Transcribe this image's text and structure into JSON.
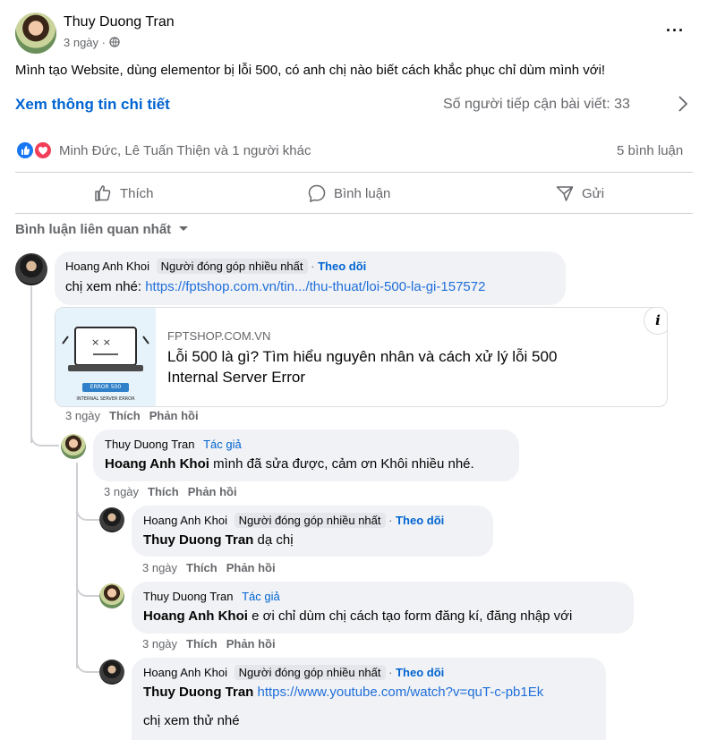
{
  "post": {
    "author": "Thuy Duong Tran",
    "time": "3 ngày",
    "privacy_icon": "globe-icon",
    "text": "Mình tạo Website, dùng elementor bị lỗi 500, có anh chị nào biết cách khắc phục chỉ dùm mình với!",
    "details_link": "Xem thông tin chi tiết",
    "reach": "Số người tiếp cận bài viết: 33",
    "reactors": "Minh Đức, Lê Tuấn Thiện và 1 người khác",
    "comment_count": "5 bình luận"
  },
  "actions": {
    "like": "Thích",
    "comment": "Bình luận",
    "share": "Gửi"
  },
  "sort_label": "Bình luận liên quan nhất",
  "comments": [
    {
      "author": "Hoang Anh Khoi",
      "badge": "Người đóng góp nhiều nhất",
      "follow": "Theo dõi",
      "text": "chị xem nhé: ",
      "link": "https://fptshop.com.vn/tin.../thu-thuat/loi-500-la-gi-157572",
      "time": "3 ngày",
      "like": "Thích",
      "reply": "Phản hồi"
    },
    {
      "author": "Thuy Duong Tran",
      "badge": "Tác giả",
      "mention": "Hoang Anh Khoi",
      "text": " mình đã sửa được, cảm ơn Khôi nhiều nhé.",
      "time": "3 ngày",
      "like": "Thích",
      "reply": "Phản hồi"
    },
    {
      "author": "Hoang Anh Khoi",
      "badge": "Người đóng góp nhiều nhất",
      "follow": "Theo dõi",
      "mention": "Thuy Duong Tran",
      "text": " dạ chị",
      "time": "3 ngày",
      "like": "Thích",
      "reply": "Phản hồi"
    },
    {
      "author": "Thuy Duong Tran",
      "badge": "Tác giả",
      "mention": "Hoang Anh Khoi",
      "text": " e ơi chỉ dùm chị cách tạo form đăng kí, đăng nhập với",
      "time": "3 ngày",
      "like": "Thích",
      "reply": "Phản hồi"
    },
    {
      "author": "Hoang Anh Khoi",
      "badge": "Người đóng góp nhiều nhất",
      "follow": "Theo dõi",
      "mention": "Thuy Duong Tran",
      "link": "https://www.youtube.com/watch?v=quT-c-pb1Ek",
      "text2": "chị xem thử nhé"
    }
  ],
  "link_preview": {
    "domain": "FPTSHOP.COM.VN",
    "title_line1": "Lỗi 500 là gì? Tìm hiểu nguyên nhân và cách xử lý lỗi 500",
    "title_line2": "Internal Server Error",
    "thumb_label": "ERROR 500",
    "thumb_sub": "INTERNAL SERVER ERROR"
  },
  "colors": {
    "link": "#216fdb",
    "like_blue": "#1877f2",
    "love_red": "#f33e58"
  }
}
